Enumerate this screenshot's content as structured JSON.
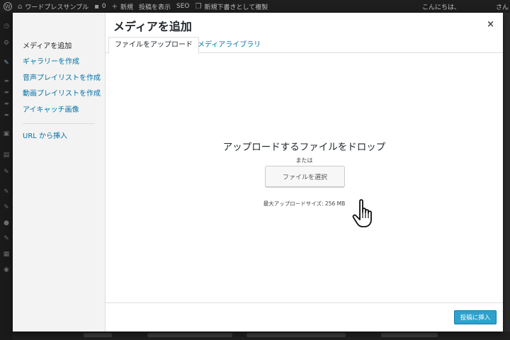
{
  "admin_bar": {
    "site_name": "ワードプレスサンプル",
    "comment_count": "0",
    "new_label": "新規",
    "view_post": "投稿を表示",
    "seo": "SEO",
    "new_draft": "新規下書きとして複製",
    "greeting": "こんにちは、",
    "user_initial": "さん"
  },
  "modal": {
    "title": "メディアを追加",
    "close_icon": "×",
    "menu": [
      {
        "label": "メディアを追加"
      },
      {
        "label": "ギャラリーを作成"
      },
      {
        "label": "音声プレイリストを作成"
      },
      {
        "label": "動画プレイリストを作成"
      },
      {
        "label": "アイキャッチ画像"
      }
    ],
    "menu_extra": {
      "label": "URL から挿入"
    },
    "tabs": [
      {
        "label": "ファイルをアップロード"
      },
      {
        "label": "メディアライブラリ"
      }
    ],
    "uploader": {
      "drop_text": "アップロードするファイルをドロップ",
      "or_text": "または",
      "select_button": "ファイルを選択",
      "max_size": "最大アップロードサイズ: 256 MB"
    },
    "insert_button": "投稿に挿入"
  },
  "colors": {
    "accent": "#2ea2cc",
    "link": "#0073aa"
  }
}
